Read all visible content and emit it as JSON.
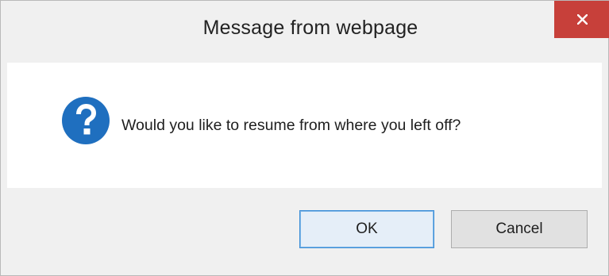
{
  "dialog": {
    "title": "Message from webpage",
    "close_icon": "close-icon",
    "message": "Would you like to resume from where you left off?",
    "message_icon": "question-icon",
    "buttons": {
      "ok_label": "OK",
      "cancel_label": "Cancel"
    }
  },
  "colors": {
    "close_button": "#c7403a",
    "question_icon": "#1f6fbf",
    "default_button_border": "#3c8fd8",
    "chrome_background": "#f0f0f0",
    "content_background": "#ffffff"
  }
}
